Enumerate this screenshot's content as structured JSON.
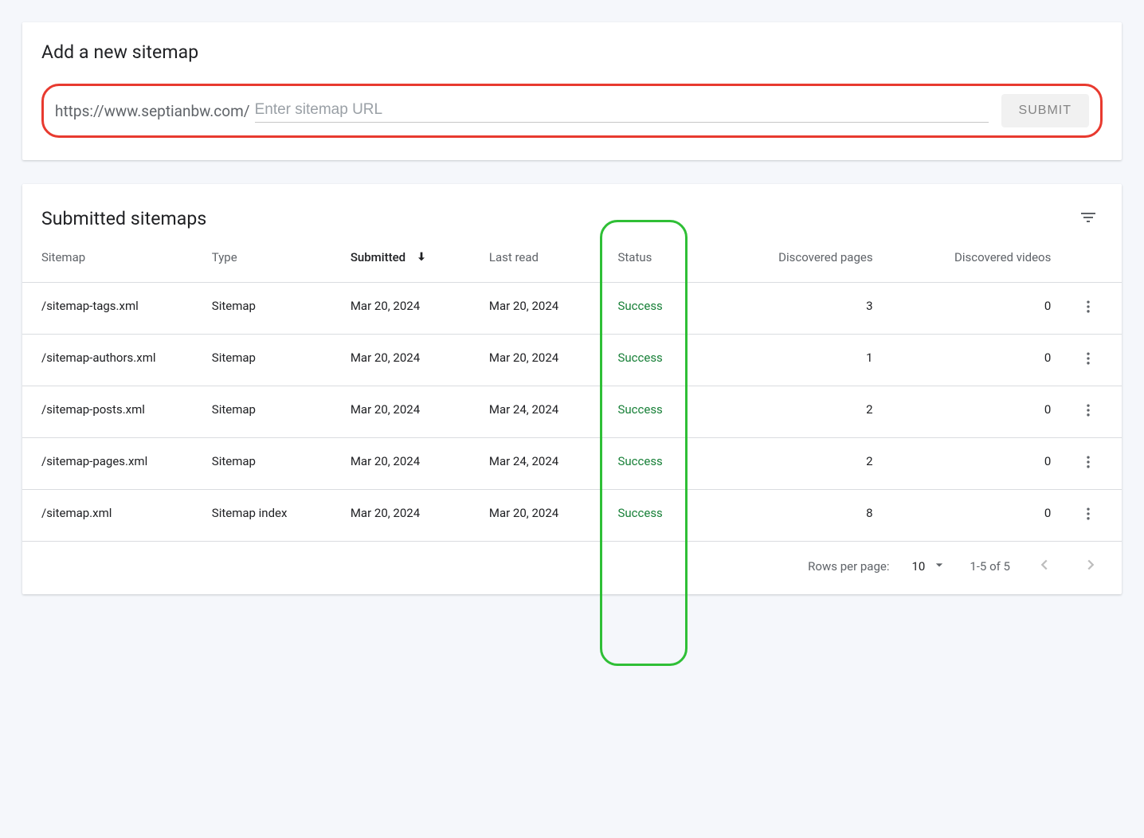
{
  "add_card": {
    "title": "Add a new sitemap",
    "url_prefix": "https://www.septianbw.com/",
    "input_placeholder": "Enter sitemap URL",
    "submit_label": "SUBMIT"
  },
  "list_card": {
    "title": "Submitted sitemaps"
  },
  "columns": {
    "sitemap": "Sitemap",
    "type": "Type",
    "submitted": "Submitted",
    "last_read": "Last read",
    "status": "Status",
    "discovered_pages": "Discovered pages",
    "discovered_videos": "Discovered videos"
  },
  "rows": [
    {
      "sitemap": "/sitemap-tags.xml",
      "type": "Sitemap",
      "submitted": "Mar 20, 2024",
      "last_read": "Mar 20, 2024",
      "status": "Success",
      "pages": "3",
      "videos": "0"
    },
    {
      "sitemap": "/sitemap-authors.xml",
      "type": "Sitemap",
      "submitted": "Mar 20, 2024",
      "last_read": "Mar 20, 2024",
      "status": "Success",
      "pages": "1",
      "videos": "0"
    },
    {
      "sitemap": "/sitemap-posts.xml",
      "type": "Sitemap",
      "submitted": "Mar 20, 2024",
      "last_read": "Mar 24, 2024",
      "status": "Success",
      "pages": "2",
      "videos": "0"
    },
    {
      "sitemap": "/sitemap-pages.xml",
      "type": "Sitemap",
      "submitted": "Mar 20, 2024",
      "last_read": "Mar 24, 2024",
      "status": "Success",
      "pages": "2",
      "videos": "0"
    },
    {
      "sitemap": "/sitemap.xml",
      "type": "Sitemap index",
      "submitted": "Mar 20, 2024",
      "last_read": "Mar 20, 2024",
      "status": "Success",
      "pages": "8",
      "videos": "0"
    }
  ],
  "pagination": {
    "rows_label": "Rows per page:",
    "rows_value": "10",
    "range": "1-5 of 5"
  }
}
